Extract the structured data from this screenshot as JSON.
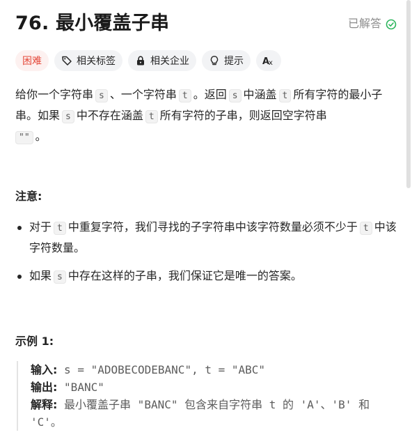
{
  "title": "76. 最小覆盖子串",
  "status": {
    "label": "已解答",
    "icon": "check-circle-icon",
    "color": "#2db55d"
  },
  "tags": {
    "difficulty": "困难",
    "related_tags": "相关标签",
    "related_companies": "相关企业",
    "hint": "提示",
    "font_toggle_icon": "translate-font-icon"
  },
  "description": {
    "p1_a": "给你一个字符串",
    "p1_s": "s",
    "p1_b": "、一个字符串",
    "p1_t": "t",
    "p1_c": "。返回",
    "p1_s2": "s",
    "p1_d": "中涵盖",
    "p1_t2": "t",
    "p1_e": "所有字符的最小子串。如果",
    "p1_s3": "s",
    "p1_f": "中不存在涵盖",
    "p1_t3": "t",
    "p1_g": "所有字符的子串，则返回空字符串",
    "p1_empty": "\"\"",
    "p1_h": "。"
  },
  "notes": {
    "heading": "注意:",
    "item1_a": "对于",
    "item1_t": "t",
    "item1_b": "中重复字符，我们寻找的子字符串中该字符数量必须不少于",
    "item1_t2": "t",
    "item1_c": "中该字符数量。",
    "item2_a": "如果",
    "item2_s": "s",
    "item2_b": "中存在这样的子串，我们保证它是唯一的答案。"
  },
  "example": {
    "heading": "示例 1:",
    "input_label": "输入:",
    "input_value": "s = \"ADOBECODEBANC\", t = \"ABC\"",
    "output_label": "输出:",
    "output_value": "\"BANC\"",
    "explain_label": "解释:",
    "explain_value": "最小覆盖子串 \"BANC\" 包含来自字符串 t 的 'A'、'B' 和 'C'。"
  },
  "colors": {
    "difficulty_hard": "#e54b3c",
    "solved_check": "#2db55d"
  }
}
